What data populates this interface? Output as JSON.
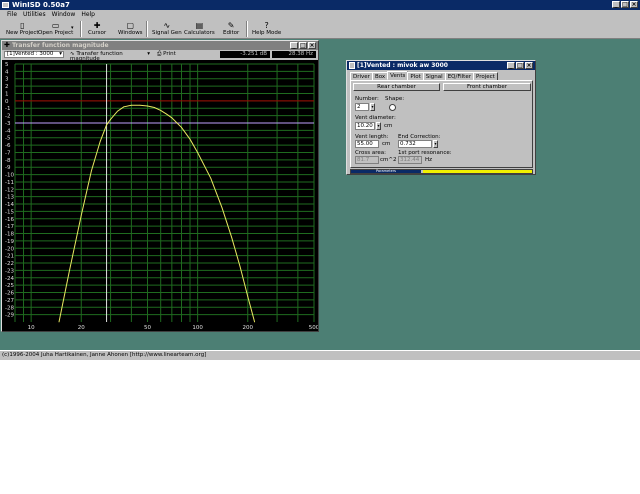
{
  "app": {
    "title": "WinISD 0.50a7",
    "menu": [
      "File",
      "Utilities",
      "Window",
      "Help"
    ],
    "toolbar": [
      {
        "label": "New Project",
        "icon": "new-project-icon",
        "glyph": "▯"
      },
      {
        "label": "Open Project",
        "icon": "open-project-icon",
        "glyph": "▭"
      },
      {
        "label": "Cursor",
        "icon": "cursor-icon",
        "glyph": "✚"
      },
      {
        "label": "Windows",
        "icon": "windows-icon",
        "glyph": "▢"
      },
      {
        "label": "Signal Gen",
        "icon": "signal-gen-icon",
        "glyph": "∿"
      },
      {
        "label": "Calculators",
        "icon": "calculators-icon",
        "glyph": "▤"
      },
      {
        "label": "Editor",
        "icon": "editor-icon",
        "glyph": "✎"
      },
      {
        "label": "Help Mode",
        "icon": "help-mode-icon",
        "glyph": "?"
      }
    ],
    "status": "(c)1996-2004 Juha Hartikainen, Janne Ahonen [http://www.linearteam.org]"
  },
  "graph_window": {
    "title": "Transfer function magnitude",
    "project_select": "[1]Vented : 3000",
    "graph_select": "Transfer function magnitude",
    "print_label": "Print",
    "cursor_db": "-3.251 dB",
    "cursor_hz": "28.38 Hz"
  },
  "vent_window": {
    "title": "[1]Vented : mivok aw 3000",
    "tabs": [
      "Driver",
      "Box",
      "Vents",
      "Plot",
      "Signal",
      "EQ/Filter",
      "Project"
    ],
    "active_tab": "Vents",
    "rear_chamber": "Rear chamber",
    "front_chamber": "Front chamber",
    "number_label": "Number:",
    "number_value": "2",
    "shape_label": "Shape:",
    "vent_diameter_label": "Vent diameter:",
    "vent_diameter_value": "10.20",
    "vent_diameter_unit": "cm",
    "vent_length_label": "Vent length:",
    "vent_length_value": "55.00",
    "vent_length_unit": "cm",
    "end_correction_label": "End Correction:",
    "end_correction_value": "0.732",
    "cross_area_label": "Cross area:",
    "cross_area_value": "81.7",
    "cross_area_unit": "cm^2",
    "port_resonance_label": "1st port resonance:",
    "port_resonance_value": "312.44",
    "port_resonance_unit": "Hz",
    "parameters_label": "Parameters"
  },
  "chart_data": {
    "type": "line",
    "x_scale": "log",
    "xlim": [
      8,
      500
    ],
    "ylim": [
      -30,
      5
    ],
    "x_ticks": [
      10,
      20,
      50,
      100,
      200,
      500
    ],
    "y_ticks": [
      5,
      4,
      3,
      2,
      1,
      0,
      -1,
      -2,
      -3,
      -4,
      -5,
      -6,
      -7,
      -8,
      -9,
      -10,
      -11,
      -12,
      -13,
      -14,
      -15,
      -16,
      -17,
      -18,
      -19,
      -20,
      -21,
      -22,
      -23,
      -24,
      -25,
      -26,
      -27,
      -28,
      -29
    ],
    "grid": true,
    "series": [
      {
        "color": "#e8e860",
        "x": [
          14.7,
          17,
          20,
          23,
          26,
          28.38,
          30,
          33,
          36,
          40,
          45,
          50,
          55,
          60,
          65,
          70,
          80,
          90,
          100,
          120,
          140,
          160,
          180,
          200,
          220
        ],
        "y": [
          -30,
          -23,
          -15.5,
          -9.5,
          -5.5,
          -3.25,
          -2.5,
          -1.4,
          -0.8,
          -0.6,
          -0.6,
          -0.7,
          -0.9,
          -1.3,
          -1.8,
          -2.3,
          -3.6,
          -5.2,
          -7.0,
          -10.5,
          -14.5,
          -18.5,
          -22.5,
          -26.5,
          -30
        ]
      }
    ],
    "reference_lines": [
      {
        "axis": "y",
        "value": 0,
        "color": "#a00000"
      },
      {
        "axis": "y",
        "value": -3,
        "color": "#c0a0ff"
      }
    ],
    "cursor": {
      "x": 28.38,
      "y": -3.251
    }
  }
}
